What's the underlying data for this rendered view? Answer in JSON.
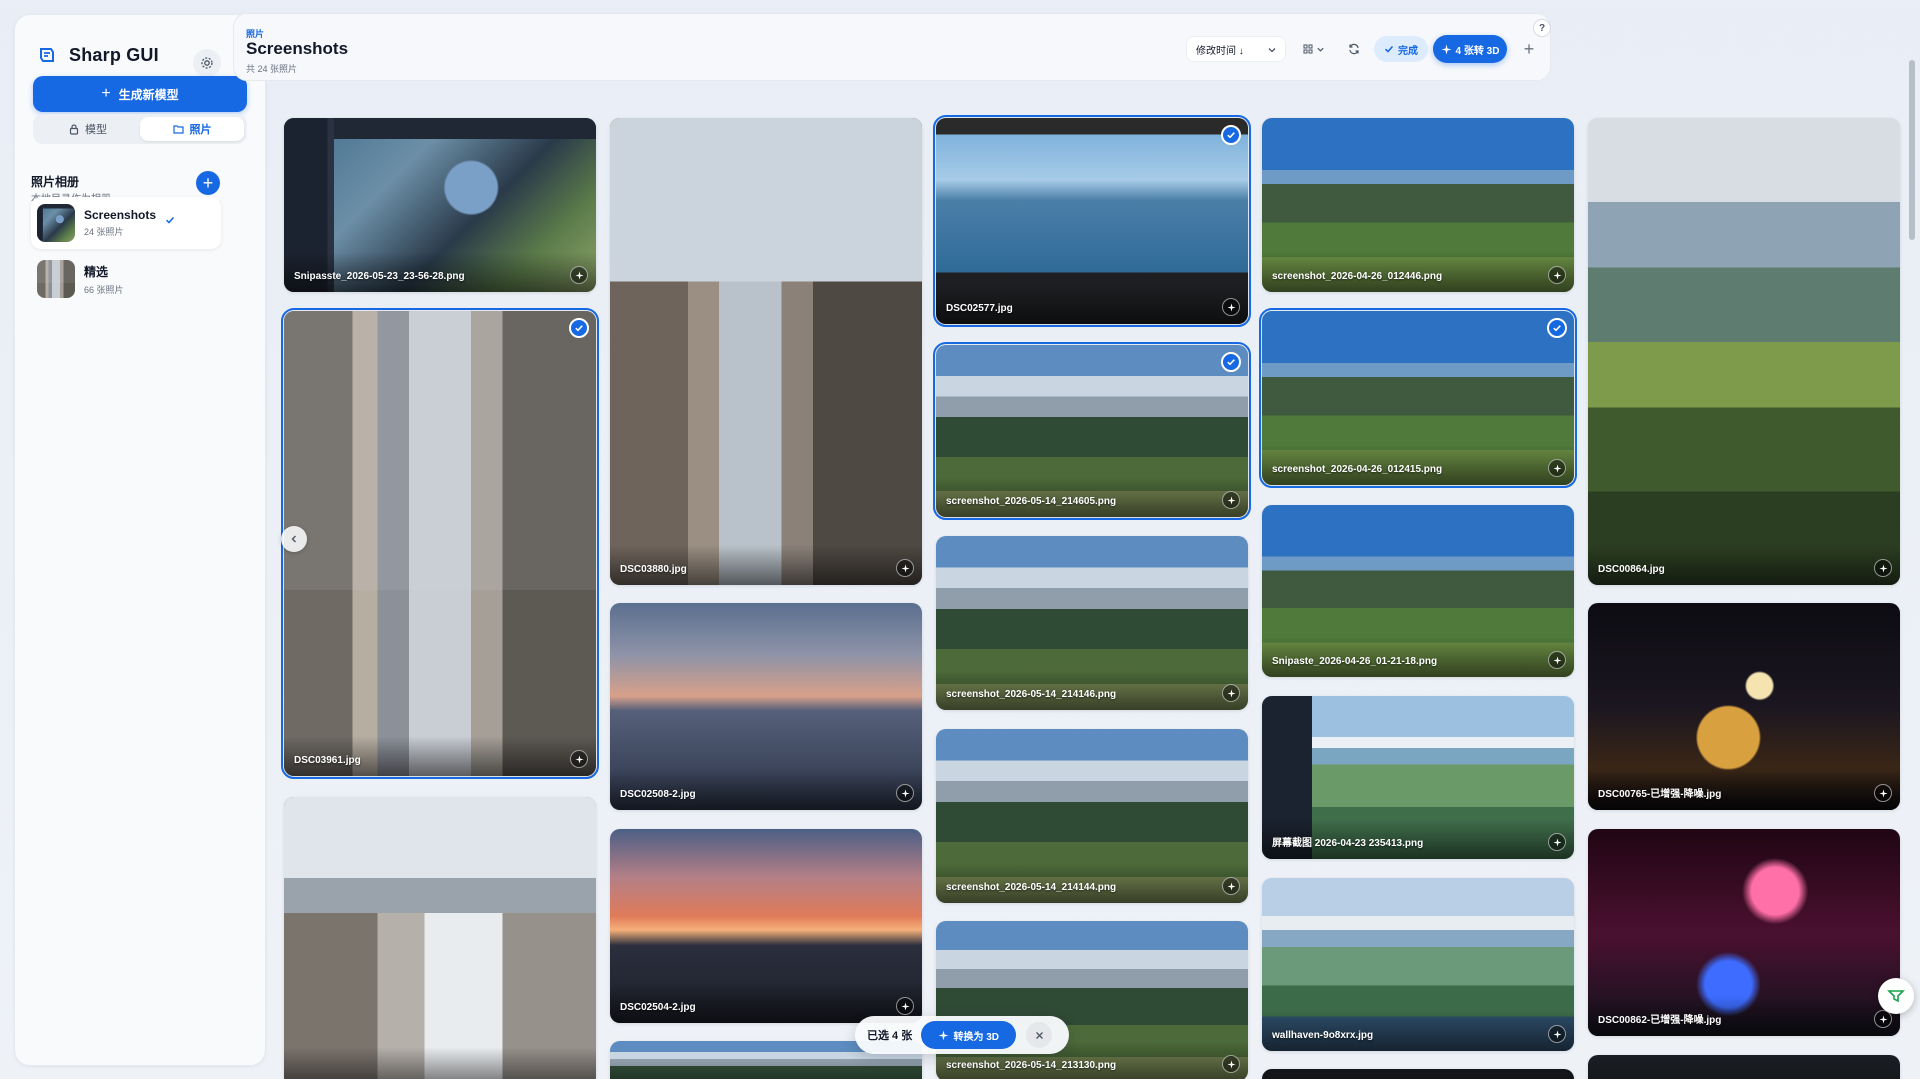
{
  "app": {
    "name": "Sharp GUI",
    "lang": "EN"
  },
  "sidebar": {
    "create_label": "生成新模型",
    "segments": [
      {
        "label": "模型",
        "icon": "lock-icon"
      },
      {
        "label": "照片",
        "icon": "folder-icon"
      }
    ],
    "albums_title": "照片相册",
    "albums_subtitle": "本地目录作为相册",
    "albums": [
      {
        "name": "Screenshots",
        "count": "24 张照片",
        "active": true
      },
      {
        "name": "精选",
        "count": "66 张照片",
        "active": false
      }
    ]
  },
  "header": {
    "breadcrumb": "照片",
    "title": "Screenshots",
    "count": "共 24 张照片",
    "sort_label": "修改时间 ↓",
    "done_label": "完成",
    "convert_label": "4 张转 3D"
  },
  "photos": [
    {
      "name": "Snipasste_2026-05-23_23-56-28.png",
      "selected": false,
      "scene": "sc-ui"
    },
    {
      "name": "DSC03961.jpg",
      "selected": true,
      "scene": "sc-street"
    },
    {
      "name": "",
      "selected": false,
      "scene": "sc-street3"
    },
    {
      "name": "DSC03880.jpg",
      "selected": false,
      "scene": "sc-street2"
    },
    {
      "name": "DSC02508-2.jpg",
      "selected": false,
      "scene": "sc-sunset"
    },
    {
      "name": "DSC02504-2.jpg",
      "selected": false,
      "scene": "sc-sunset2"
    },
    {
      "name": "",
      "selected": false,
      "scene": "sc-mount2"
    },
    {
      "name": "DSC02577.jpg",
      "selected": true,
      "scene": "sc-room"
    },
    {
      "name": "screenshot_2026-05-14_214605.png",
      "selected": true,
      "scene": "sc-mount2"
    },
    {
      "name": "screenshot_2026-05-14_214146.png",
      "selected": false,
      "scene": "sc-mount2"
    },
    {
      "name": "screenshot_2026-05-14_214144.png",
      "selected": false,
      "scene": "sc-mount2"
    },
    {
      "name": "screenshot_2026-05-14_213130.png",
      "selected": false,
      "scene": "sc-mount2"
    },
    {
      "name": "screenshot_2026-04-26_012446.png",
      "selected": false,
      "scene": "sc-mount"
    },
    {
      "name": "screenshot_2026-04-26_012415.png",
      "selected": true,
      "scene": "sc-mount"
    },
    {
      "name": "Snipaste_2026-04-26_01-21-18.png",
      "selected": false,
      "scene": "sc-mount"
    },
    {
      "name": "屏幕截图 2026-04-23 235413.png",
      "selected": false,
      "scene": "sc-anime2"
    },
    {
      "name": "wallhaven-9o8xrx.jpg",
      "selected": false,
      "scene": "sc-anime"
    },
    {
      "name": "",
      "selected": false,
      "scene": "sc-dark"
    },
    {
      "name": "DSC00864.jpg",
      "selected": false,
      "scene": "sc-valley"
    },
    {
      "name": "DSC00765-已增强-降噪.jpg",
      "selected": false,
      "scene": "sc-fire"
    },
    {
      "name": "DSC00862-已增强-降噪.jpg",
      "selected": false,
      "scene": "sc-fire2"
    },
    {
      "name": "",
      "selected": false,
      "scene": "sc-dark"
    }
  ],
  "bulkbar": {
    "count_label": "已选 4 张",
    "convert_label": "转换为 3D"
  },
  "colors": {
    "accent": "#1668e3",
    "accent_light": "#dcecfd",
    "background": "#eef2f7"
  }
}
